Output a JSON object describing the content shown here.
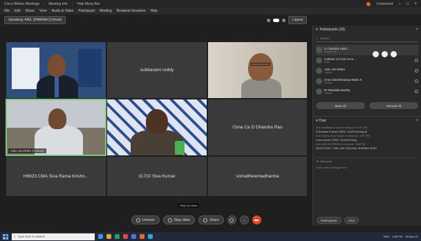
{
  "titlebar": {
    "title": "Cisco Webex Meetings",
    "segment2": "Meeting Info",
    "segment3": "Hide Menu Bar",
    "recording_label": "Connected"
  },
  "menu": [
    "File",
    "Edit",
    "Share",
    "View",
    "Audio & Video",
    "Participant",
    "Meeting",
    "Breakout Sessions",
    "Help"
  ],
  "toolbar": {
    "speaking": "Speaking: ANIL SHARMA (Cohost)",
    "layout_label": "Layout"
  },
  "tiles": [
    {
      "name": "",
      "type": "video",
      "scene": "man-suit"
    },
    {
      "name": "subbarami reddy",
      "type": "name"
    },
    {
      "name": "",
      "type": "video",
      "scene": "man-glasses"
    },
    {
      "name": "",
      "type": "video",
      "scene": "man-speaking",
      "tag": "ANIL SHARMA (Cohost)",
      "active": true
    },
    {
      "name": "",
      "type": "video",
      "scene": "woman"
    },
    {
      "name": "Cima Ca D Dhandra Rao",
      "type": "name"
    },
    {
      "name": "H6623 CMA Siva Rama Krishn...",
      "type": "name"
    },
    {
      "name": "31732 Siva Kumar",
      "type": "name"
    },
    {
      "name": "srimalthewmadharma",
      "type": "name"
    }
  ],
  "hover_tip": "Stop my video",
  "controls": {
    "mute": "Unmute",
    "video": "Stop video",
    "share": "Share"
  },
  "participants": {
    "header": "Participants (33)",
    "search_placeholder": "Search",
    "list": [
      {
        "name": "S Chandra Sekh...",
        "sub": "Cohost, me"
      },
      {
        "name": "Institute of Cost Acco...",
        "sub": "Host"
      },
      {
        "name": "ANIL SHARMA",
        "sub": "Cohost"
      },
      {
        "name": "Cma Subrahmanya Babu K",
        "sub": "Cohost"
      },
      {
        "name": "Dr.Nandala Murthy",
        "sub": "Cohost"
      }
    ],
    "btn_mute_all": "Mute All",
    "btn_unmute_all": "Unmute All"
  },
  "chat": {
    "header": "Chat",
    "messages": [
      {
        "meta": "from subbarami reddy to everyone:   4:57 PM",
        "text": "G Bhaskar Prasad 31554. Good Evening all"
      },
      {
        "meta": "from Sarma Siva Kumar to everyone:   4:57 PM",
        "text": "Cma Suman 31554. Good Evening"
      },
      {
        "meta": "from ANIL SHARMA to everyone:   4:58 PM",
        "text": "99123 31997. CMA I AM SIVA ANIL SHARMA 31997"
      }
    ],
    "to_label": "To: Everyone",
    "input_placeholder": "Enter chat message here"
  },
  "panel_footer": {
    "participants": "Participants",
    "chat": "Chat"
  },
  "taskbar": {
    "search_placeholder": "Type here to search",
    "time": "4:59 PM",
    "date": "29-Nov-21",
    "lang": "ENG"
  }
}
